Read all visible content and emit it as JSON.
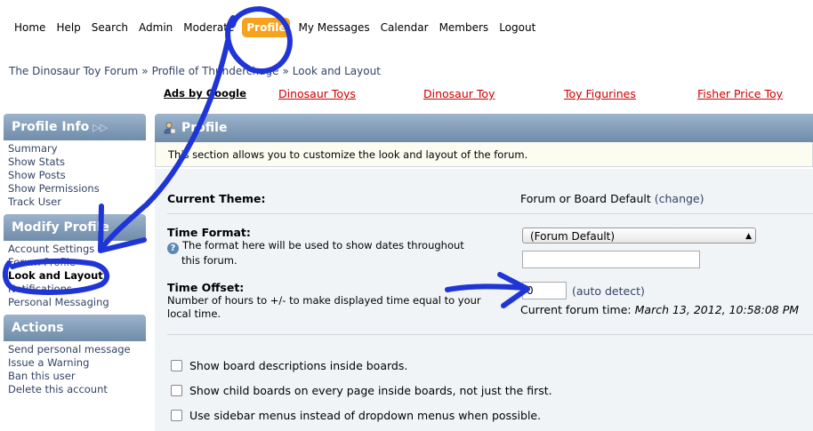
{
  "nav": {
    "items": [
      "Home",
      "Help",
      "Search",
      "Admin",
      "Moderate",
      "Profile",
      "My Messages",
      "Calendar",
      "Members",
      "Logout"
    ],
    "active": "Profile"
  },
  "breadcrumb": [
    "The Dinosaur Toy Forum",
    "Profile of Thunderchage",
    "Look and Layout"
  ],
  "ads": {
    "label": "Ads by Google",
    "links": [
      "Dinosaur Toys",
      "Dinosaur Toy",
      "Toy Figurines",
      "Fisher Price Toy"
    ]
  },
  "sidebar": {
    "profile_info": {
      "title": "Profile Info",
      "items": [
        "Summary",
        "Show Stats",
        "Show Posts",
        "Show Permissions",
        "Track User"
      ]
    },
    "modify_profile": {
      "title": "Modify Profile",
      "items": [
        "Account Settings",
        "Forum Profile",
        "Look and Layout",
        "Notifications",
        "Personal Messaging"
      ],
      "active": "Look and Layout"
    },
    "actions": {
      "title": "Actions",
      "items": [
        "Send personal message",
        "Issue a Warning",
        "Ban this user",
        "Delete this account"
      ]
    }
  },
  "main": {
    "title": "Profile",
    "intro": "This section allows you to customize the look and layout of the forum.",
    "theme": {
      "label": "Current Theme:",
      "value": "Forum or Board Default",
      "change": "(change)"
    },
    "time_format": {
      "label": "Time Format:",
      "desc_line1": "The format here will be used to show dates throughout",
      "desc_line2": "this forum.",
      "selected": "(Forum Default)",
      "custom_value": ""
    },
    "time_offset": {
      "label": "Time Offset:",
      "desc_line1": "Number of hours to +/- to make displayed time equal to your",
      "desc_line2": "local time.",
      "value": "0",
      "auto": "(auto detect)",
      "current_label": "Current forum time:",
      "current_value": "March 13, 2012, 10:58:08 PM"
    },
    "checkboxes": [
      "Show board descriptions inside boards.",
      "Show child boards on every page inside boards, not just the first.",
      "Use sidebar menus instead of dropdown menus when possible."
    ]
  },
  "colors": {
    "annotation": "#1f35d6",
    "active_tab": "#f6a21c",
    "header": "#7f9bb8",
    "ad_link": "#cc0000"
  }
}
